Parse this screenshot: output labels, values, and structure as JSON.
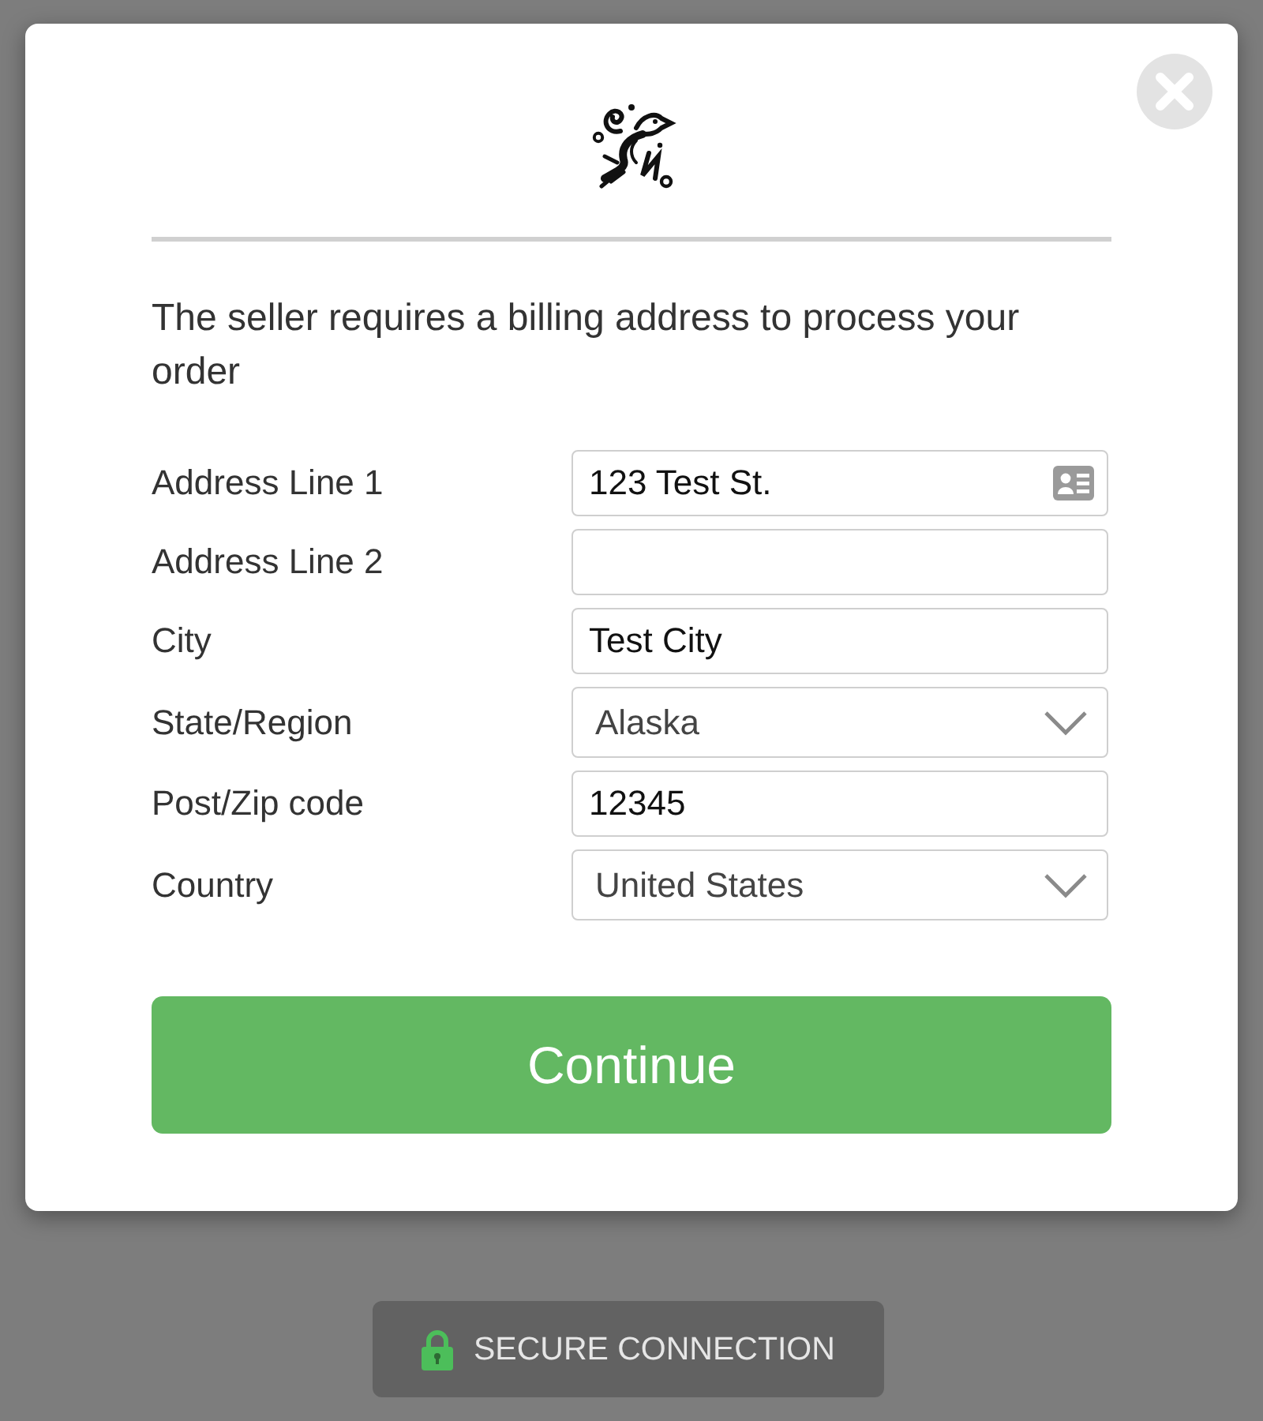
{
  "dialog": {
    "intro": "The seller requires a billing address to process your order",
    "fields": [
      {
        "kind": "input",
        "label": "Address Line 1",
        "value": "123 Test St.",
        "contact_icon": true
      },
      {
        "kind": "input",
        "label": "Address Line 2",
        "contact_icon": false
      },
      {
        "kind": "input",
        "label": "City",
        "value": "Test City",
        "contact_icon": false
      },
      {
        "kind": "select",
        "label": "State/Region",
        "value": "Alaska"
      },
      {
        "kind": "input",
        "label": "Post/Zip code",
        "value": "12345",
        "contact_icon": false
      },
      {
        "kind": "select",
        "label": "Country",
        "value": "United States"
      }
    ],
    "continue_button": "Continue"
  },
  "secure_badge": "SECURE CONNECTION"
}
